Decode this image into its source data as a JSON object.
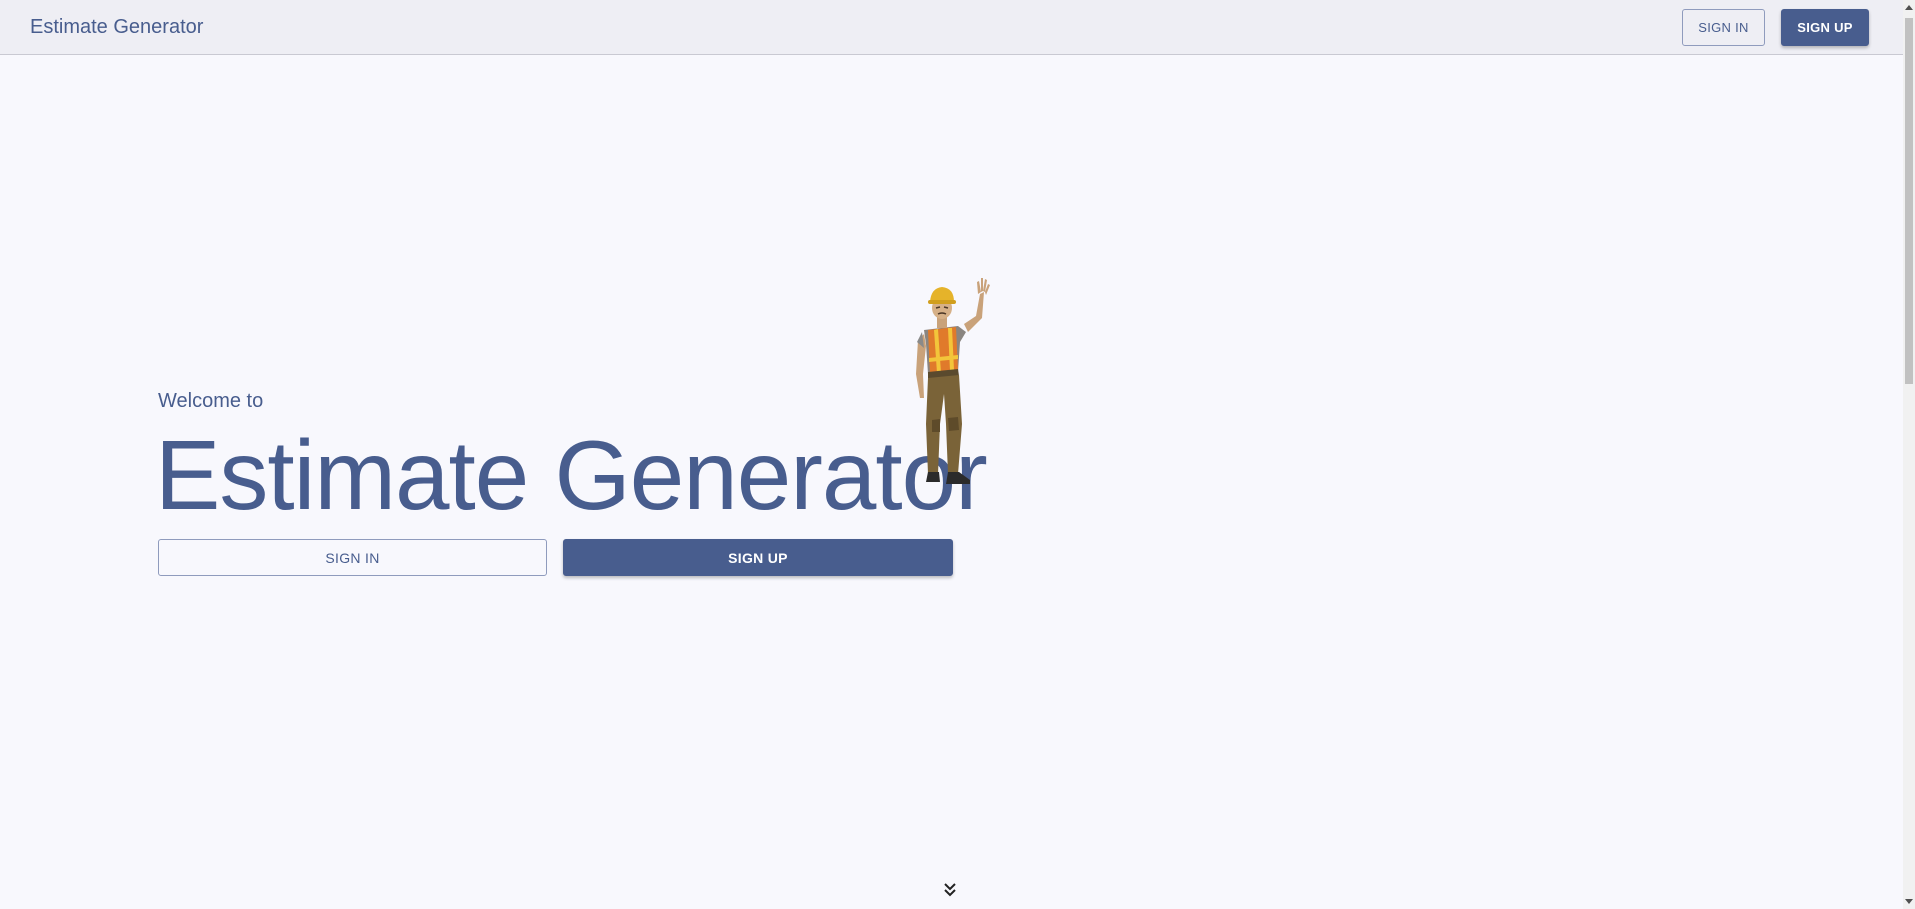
{
  "appbar": {
    "title": "Estimate Generator",
    "signin_label": "SIGN IN",
    "signup_label": "SIGN UP"
  },
  "hero": {
    "welcome": "Welcome to",
    "title": "Estimate Generator",
    "signin_label": "SIGN IN",
    "signup_label": "SIGN UP",
    "illustration": "waving-construction-worker",
    "scroll_icon": "double-chevron-down-icon"
  },
  "colors": {
    "brand": "#485d8e",
    "background": "#f8f8fd",
    "appbar": "#eeeef4"
  }
}
